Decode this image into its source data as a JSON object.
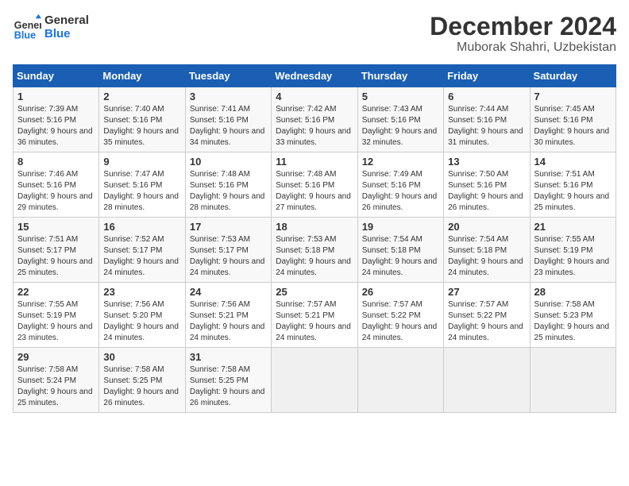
{
  "header": {
    "logo_general": "General",
    "logo_blue": "Blue",
    "title": "December 2024",
    "subtitle": "Muborak Shahri, Uzbekistan"
  },
  "calendar": {
    "days_of_week": [
      "Sunday",
      "Monday",
      "Tuesday",
      "Wednesday",
      "Thursday",
      "Friday",
      "Saturday"
    ],
    "weeks": [
      [
        {
          "day": "",
          "empty": true
        },
        {
          "day": "",
          "empty": true
        },
        {
          "day": "",
          "empty": true
        },
        {
          "day": "",
          "empty": true
        },
        {
          "day": "",
          "empty": true
        },
        {
          "day": "",
          "empty": true
        },
        {
          "day": "",
          "empty": true
        }
      ],
      [
        {
          "num": "1",
          "rise": "7:39 AM",
          "set": "5:16 PM",
          "daylight": "9 hours and 36 minutes."
        },
        {
          "num": "2",
          "rise": "7:40 AM",
          "set": "5:16 PM",
          "daylight": "9 hours and 35 minutes."
        },
        {
          "num": "3",
          "rise": "7:41 AM",
          "set": "5:16 PM",
          "daylight": "9 hours and 34 minutes."
        },
        {
          "num": "4",
          "rise": "7:42 AM",
          "set": "5:16 PM",
          "daylight": "9 hours and 33 minutes."
        },
        {
          "num": "5",
          "rise": "7:43 AM",
          "set": "5:16 PM",
          "daylight": "9 hours and 32 minutes."
        },
        {
          "num": "6",
          "rise": "7:44 AM",
          "set": "5:16 PM",
          "daylight": "9 hours and 31 minutes."
        },
        {
          "num": "7",
          "rise": "7:45 AM",
          "set": "5:16 PM",
          "daylight": "9 hours and 30 minutes."
        }
      ],
      [
        {
          "num": "8",
          "rise": "7:46 AM",
          "set": "5:16 PM",
          "daylight": "9 hours and 29 minutes."
        },
        {
          "num": "9",
          "rise": "7:47 AM",
          "set": "5:16 PM",
          "daylight": "9 hours and 28 minutes."
        },
        {
          "num": "10",
          "rise": "7:48 AM",
          "set": "5:16 PM",
          "daylight": "9 hours and 28 minutes."
        },
        {
          "num": "11",
          "rise": "7:48 AM",
          "set": "5:16 PM",
          "daylight": "9 hours and 27 minutes."
        },
        {
          "num": "12",
          "rise": "7:49 AM",
          "set": "5:16 PM",
          "daylight": "9 hours and 26 minutes."
        },
        {
          "num": "13",
          "rise": "7:50 AM",
          "set": "5:16 PM",
          "daylight": "9 hours and 26 minutes."
        },
        {
          "num": "14",
          "rise": "7:51 AM",
          "set": "5:16 PM",
          "daylight": "9 hours and 25 minutes."
        }
      ],
      [
        {
          "num": "15",
          "rise": "7:51 AM",
          "set": "5:17 PM",
          "daylight": "9 hours and 25 minutes."
        },
        {
          "num": "16",
          "rise": "7:52 AM",
          "set": "5:17 PM",
          "daylight": "9 hours and 24 minutes."
        },
        {
          "num": "17",
          "rise": "7:53 AM",
          "set": "5:17 PM",
          "daylight": "9 hours and 24 minutes."
        },
        {
          "num": "18",
          "rise": "7:53 AM",
          "set": "5:18 PM",
          "daylight": "9 hours and 24 minutes."
        },
        {
          "num": "19",
          "rise": "7:54 AM",
          "set": "5:18 PM",
          "daylight": "9 hours and 24 minutes."
        },
        {
          "num": "20",
          "rise": "7:54 AM",
          "set": "5:18 PM",
          "daylight": "9 hours and 24 minutes."
        },
        {
          "num": "21",
          "rise": "7:55 AM",
          "set": "5:19 PM",
          "daylight": "9 hours and 23 minutes."
        }
      ],
      [
        {
          "num": "22",
          "rise": "7:55 AM",
          "set": "5:19 PM",
          "daylight": "9 hours and 23 minutes."
        },
        {
          "num": "23",
          "rise": "7:56 AM",
          "set": "5:20 PM",
          "daylight": "9 hours and 24 minutes."
        },
        {
          "num": "24",
          "rise": "7:56 AM",
          "set": "5:21 PM",
          "daylight": "9 hours and 24 minutes."
        },
        {
          "num": "25",
          "rise": "7:57 AM",
          "set": "5:21 PM",
          "daylight": "9 hours and 24 minutes."
        },
        {
          "num": "26",
          "rise": "7:57 AM",
          "set": "5:22 PM",
          "daylight": "9 hours and 24 minutes."
        },
        {
          "num": "27",
          "rise": "7:57 AM",
          "set": "5:22 PM",
          "daylight": "9 hours and 24 minutes."
        },
        {
          "num": "28",
          "rise": "7:58 AM",
          "set": "5:23 PM",
          "daylight": "9 hours and 25 minutes."
        }
      ],
      [
        {
          "num": "29",
          "rise": "7:58 AM",
          "set": "5:24 PM",
          "daylight": "9 hours and 25 minutes."
        },
        {
          "num": "30",
          "rise": "7:58 AM",
          "set": "5:25 PM",
          "daylight": "9 hours and 26 minutes."
        },
        {
          "num": "31",
          "rise": "7:58 AM",
          "set": "5:25 PM",
          "daylight": "9 hours and 26 minutes."
        },
        {
          "day": "",
          "empty": true
        },
        {
          "day": "",
          "empty": true
        },
        {
          "day": "",
          "empty": true
        },
        {
          "day": "",
          "empty": true
        }
      ]
    ]
  }
}
